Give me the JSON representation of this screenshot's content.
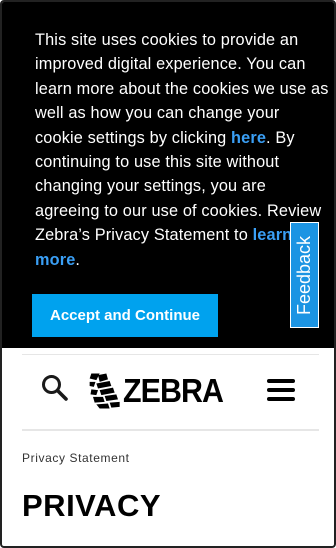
{
  "cookie_banner": {
    "text_1": "This site uses cookies to provide an improved digital experience. You can learn more about the cookies we use as well as how you can change your cookie settings by clicking ",
    "link_here": "here",
    "text_2": ".  By continuing to use this site without changing your settings, you are agreeing to our use of cookies. Review Zebra’s Privacy Statement to ",
    "link_learn_more": "learn more",
    "text_3": ".",
    "accept_button": "Accept and Continue"
  },
  "feedback": {
    "label": "Feedback"
  },
  "header": {
    "search_icon": "search-icon",
    "logo_text": "ZEBRA",
    "menu_icon": "hamburger-menu-icon"
  },
  "breadcrumb": {
    "label": "Privacy Statement"
  },
  "page": {
    "title": "PRIVACY"
  },
  "colors": {
    "banner_bg": "#000000",
    "link": "#3a9ff5",
    "accept_button": "#00a2ee",
    "feedback_tab": "#1b94e3"
  }
}
